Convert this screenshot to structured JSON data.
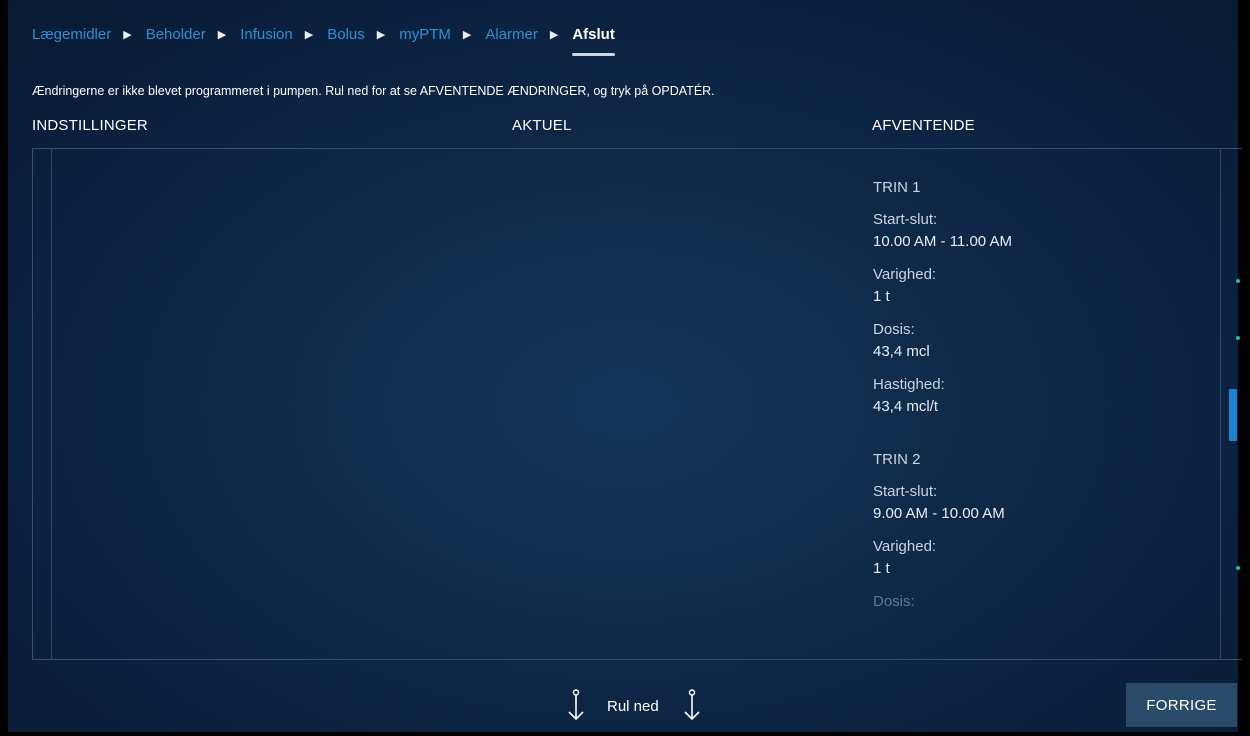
{
  "breadcrumb": {
    "items": [
      "Lægemidler",
      "Beholder",
      "Infusion",
      "Bolus",
      "myPTM",
      "Alarmer"
    ],
    "current": "Afslut",
    "separator": "▶"
  },
  "message": "Ændringerne er ikke blevet programmeret i pumpen. Rul ned for at se AFVENTENDE ÆNDRINGER, og tryk på OPDATÉR.",
  "columns": {
    "settings": "INDSTILLINGER",
    "current": "AKTUEL",
    "pending": "AFVENTENDE"
  },
  "pending": {
    "steps": [
      {
        "title": "TRIN 1",
        "fields": [
          {
            "label": "Start-slut:",
            "value": "10.00 AM - 11.00 AM"
          },
          {
            "label": "Varighed:",
            "value": "1 t"
          },
          {
            "label": "Dosis:",
            "value": "43,4 mcl"
          },
          {
            "label": "Hastighed:",
            "value": "43,4 mcl/t"
          }
        ]
      },
      {
        "title": "TRIN 2",
        "fields": [
          {
            "label": "Start-slut:",
            "value": "9.00 AM - 10.00 AM"
          },
          {
            "label": "Varighed:",
            "value": "1 t"
          }
        ],
        "partial_label": "Dosis:"
      }
    ]
  },
  "footer": {
    "scroll_label": "Rul ned",
    "prev_button": "FORRIGE"
  },
  "colors": {
    "link": "#2f8fd3",
    "accent": "#1c83d3",
    "marker": "#1fc39a",
    "button": "#2a4a69"
  }
}
